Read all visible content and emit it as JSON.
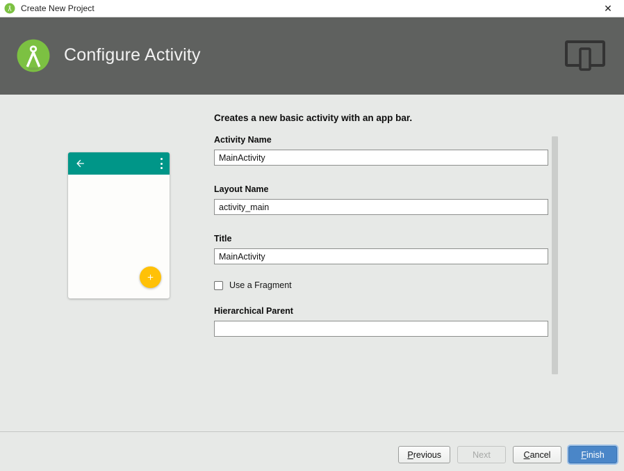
{
  "window": {
    "title": "Create New Project",
    "app_icon": "android-studio-icon",
    "close_icon": "close-icon",
    "close_label": "✕"
  },
  "header": {
    "title": "Configure Activity",
    "logo_icon": "android-studio-logo",
    "device_icon": "device-preview-icon",
    "background_color": "#5f615f"
  },
  "main": {
    "intro": "Creates a new basic activity with an app bar.",
    "preview": {
      "name": "activity-preview",
      "appbar_color": "#009688",
      "fab_color": "#ffc107",
      "back_icon": "back-arrow-icon",
      "overflow_icon": "overflow-menu-icon",
      "fab_icon": "add-icon"
    },
    "fields": [
      {
        "label": "Activity Name",
        "value": "MainActivity",
        "placeholder": "",
        "name": "activity-name"
      },
      {
        "label": "Layout Name",
        "value": "activity_main",
        "placeholder": "",
        "name": "layout-name"
      },
      {
        "label": "Title",
        "value": "MainActivity",
        "placeholder": "",
        "name": "title"
      },
      {
        "label": "Hierarchical Parent",
        "value": "",
        "placeholder": "",
        "name": "hierarchical-parent"
      }
    ],
    "checkbox": {
      "label": "Use a Fragment",
      "checked": false
    }
  },
  "footer": {
    "buttons": [
      {
        "label": "Previous",
        "mnemonic": "P",
        "state": "enabled",
        "style": "default"
      },
      {
        "label": "Next",
        "mnemonic": "",
        "state": "disabled",
        "style": "default"
      },
      {
        "label": "Cancel",
        "mnemonic": "C",
        "state": "enabled",
        "style": "default"
      },
      {
        "label": "Finish",
        "mnemonic": "F",
        "state": "enabled",
        "style": "primary"
      }
    ]
  },
  "colors": {
    "header_bg": "#5f615f",
    "body_bg": "#e7e9e7",
    "accent_teal": "#009688",
    "accent_amber": "#ffc107",
    "primary_blue": "#4a86c8",
    "logo_green": "#7cc142"
  }
}
